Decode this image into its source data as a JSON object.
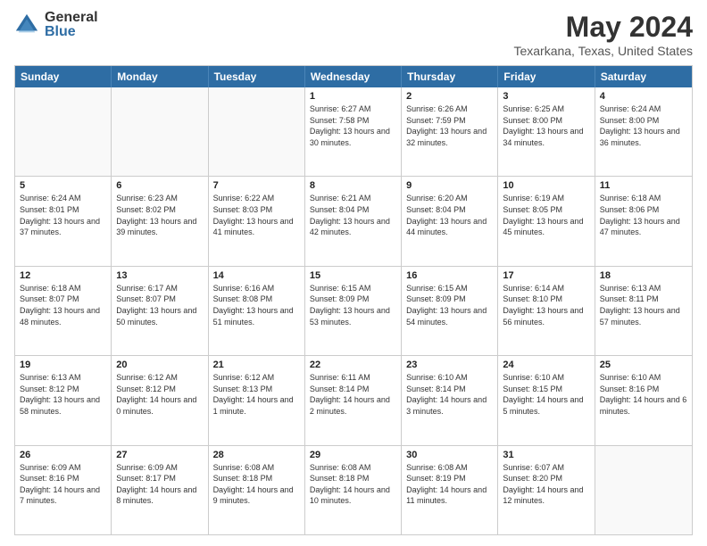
{
  "header": {
    "logo": {
      "general": "General",
      "blue": "Blue"
    },
    "title": "May 2024",
    "subtitle": "Texarkana, Texas, United States"
  },
  "days_of_week": [
    "Sunday",
    "Monday",
    "Tuesday",
    "Wednesday",
    "Thursday",
    "Friday",
    "Saturday"
  ],
  "weeks": [
    [
      {
        "day": "",
        "empty": true
      },
      {
        "day": "",
        "empty": true
      },
      {
        "day": "",
        "empty": true
      },
      {
        "day": "1",
        "sunrise": "6:27 AM",
        "sunset": "7:58 PM",
        "daylight": "13 hours and 30 minutes."
      },
      {
        "day": "2",
        "sunrise": "6:26 AM",
        "sunset": "7:59 PM",
        "daylight": "13 hours and 32 minutes."
      },
      {
        "day": "3",
        "sunrise": "6:25 AM",
        "sunset": "8:00 PM",
        "daylight": "13 hours and 34 minutes."
      },
      {
        "day": "4",
        "sunrise": "6:24 AM",
        "sunset": "8:00 PM",
        "daylight": "13 hours and 36 minutes."
      }
    ],
    [
      {
        "day": "5",
        "sunrise": "6:24 AM",
        "sunset": "8:01 PM",
        "daylight": "13 hours and 37 minutes."
      },
      {
        "day": "6",
        "sunrise": "6:23 AM",
        "sunset": "8:02 PM",
        "daylight": "13 hours and 39 minutes."
      },
      {
        "day": "7",
        "sunrise": "6:22 AM",
        "sunset": "8:03 PM",
        "daylight": "13 hours and 41 minutes."
      },
      {
        "day": "8",
        "sunrise": "6:21 AM",
        "sunset": "8:04 PM",
        "daylight": "13 hours and 42 minutes."
      },
      {
        "day": "9",
        "sunrise": "6:20 AM",
        "sunset": "8:04 PM",
        "daylight": "13 hours and 44 minutes."
      },
      {
        "day": "10",
        "sunrise": "6:19 AM",
        "sunset": "8:05 PM",
        "daylight": "13 hours and 45 minutes."
      },
      {
        "day": "11",
        "sunrise": "6:18 AM",
        "sunset": "8:06 PM",
        "daylight": "13 hours and 47 minutes."
      }
    ],
    [
      {
        "day": "12",
        "sunrise": "6:18 AM",
        "sunset": "8:07 PM",
        "daylight": "13 hours and 48 minutes."
      },
      {
        "day": "13",
        "sunrise": "6:17 AM",
        "sunset": "8:07 PM",
        "daylight": "13 hours and 50 minutes."
      },
      {
        "day": "14",
        "sunrise": "6:16 AM",
        "sunset": "8:08 PM",
        "daylight": "13 hours and 51 minutes."
      },
      {
        "day": "15",
        "sunrise": "6:15 AM",
        "sunset": "8:09 PM",
        "daylight": "13 hours and 53 minutes."
      },
      {
        "day": "16",
        "sunrise": "6:15 AM",
        "sunset": "8:09 PM",
        "daylight": "13 hours and 54 minutes."
      },
      {
        "day": "17",
        "sunrise": "6:14 AM",
        "sunset": "8:10 PM",
        "daylight": "13 hours and 56 minutes."
      },
      {
        "day": "18",
        "sunrise": "6:13 AM",
        "sunset": "8:11 PM",
        "daylight": "13 hours and 57 minutes."
      }
    ],
    [
      {
        "day": "19",
        "sunrise": "6:13 AM",
        "sunset": "8:12 PM",
        "daylight": "13 hours and 58 minutes."
      },
      {
        "day": "20",
        "sunrise": "6:12 AM",
        "sunset": "8:12 PM",
        "daylight": "14 hours and 0 minutes."
      },
      {
        "day": "21",
        "sunrise": "6:12 AM",
        "sunset": "8:13 PM",
        "daylight": "14 hours and 1 minute."
      },
      {
        "day": "22",
        "sunrise": "6:11 AM",
        "sunset": "8:14 PM",
        "daylight": "14 hours and 2 minutes."
      },
      {
        "day": "23",
        "sunrise": "6:10 AM",
        "sunset": "8:14 PM",
        "daylight": "14 hours and 3 minutes."
      },
      {
        "day": "24",
        "sunrise": "6:10 AM",
        "sunset": "8:15 PM",
        "daylight": "14 hours and 5 minutes."
      },
      {
        "day": "25",
        "sunrise": "6:10 AM",
        "sunset": "8:16 PM",
        "daylight": "14 hours and 6 minutes."
      }
    ],
    [
      {
        "day": "26",
        "sunrise": "6:09 AM",
        "sunset": "8:16 PM",
        "daylight": "14 hours and 7 minutes."
      },
      {
        "day": "27",
        "sunrise": "6:09 AM",
        "sunset": "8:17 PM",
        "daylight": "14 hours and 8 minutes."
      },
      {
        "day": "28",
        "sunrise": "6:08 AM",
        "sunset": "8:18 PM",
        "daylight": "14 hours and 9 minutes."
      },
      {
        "day": "29",
        "sunrise": "6:08 AM",
        "sunset": "8:18 PM",
        "daylight": "14 hours and 10 minutes."
      },
      {
        "day": "30",
        "sunrise": "6:08 AM",
        "sunset": "8:19 PM",
        "daylight": "14 hours and 11 minutes."
      },
      {
        "day": "31",
        "sunrise": "6:07 AM",
        "sunset": "8:20 PM",
        "daylight": "14 hours and 12 minutes."
      },
      {
        "day": "",
        "empty": true
      }
    ]
  ]
}
